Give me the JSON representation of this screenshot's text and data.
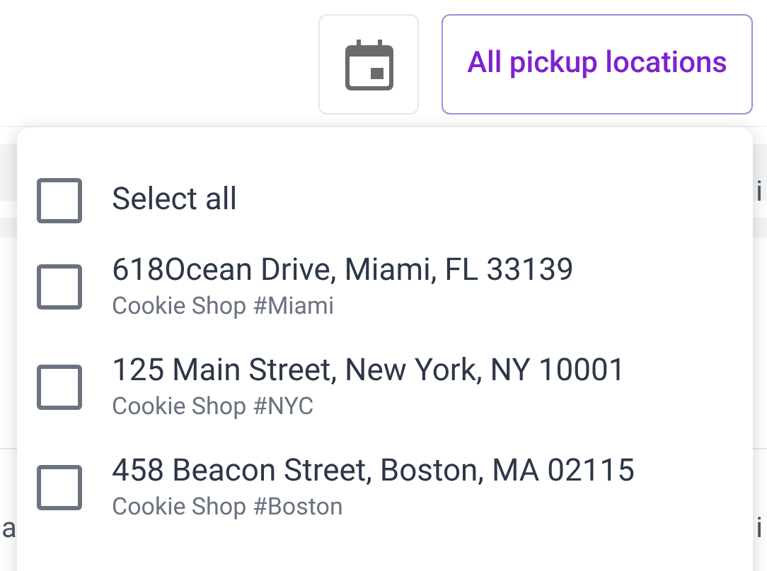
{
  "toolbar": {
    "location_filter": "All pickup locations"
  },
  "background": {
    "left_fragments": [
      "a"
    ],
    "right_fragments": [
      "i",
      "i"
    ]
  },
  "dropdown": {
    "select_all": {
      "label": "Select all",
      "checked": false
    },
    "options": [
      {
        "address": "618Ocean Drive, Miami, FL 33139",
        "shop": "Cookie Shop #Miami",
        "checked": false
      },
      {
        "address": "125 Main Street, New York, NY 10001",
        "shop": "Cookie Shop #NYC",
        "checked": false
      },
      {
        "address": "458 Beacon Street, Boston, MA 02115",
        "shop": "Cookie Shop #Boston",
        "checked": false
      }
    ]
  }
}
